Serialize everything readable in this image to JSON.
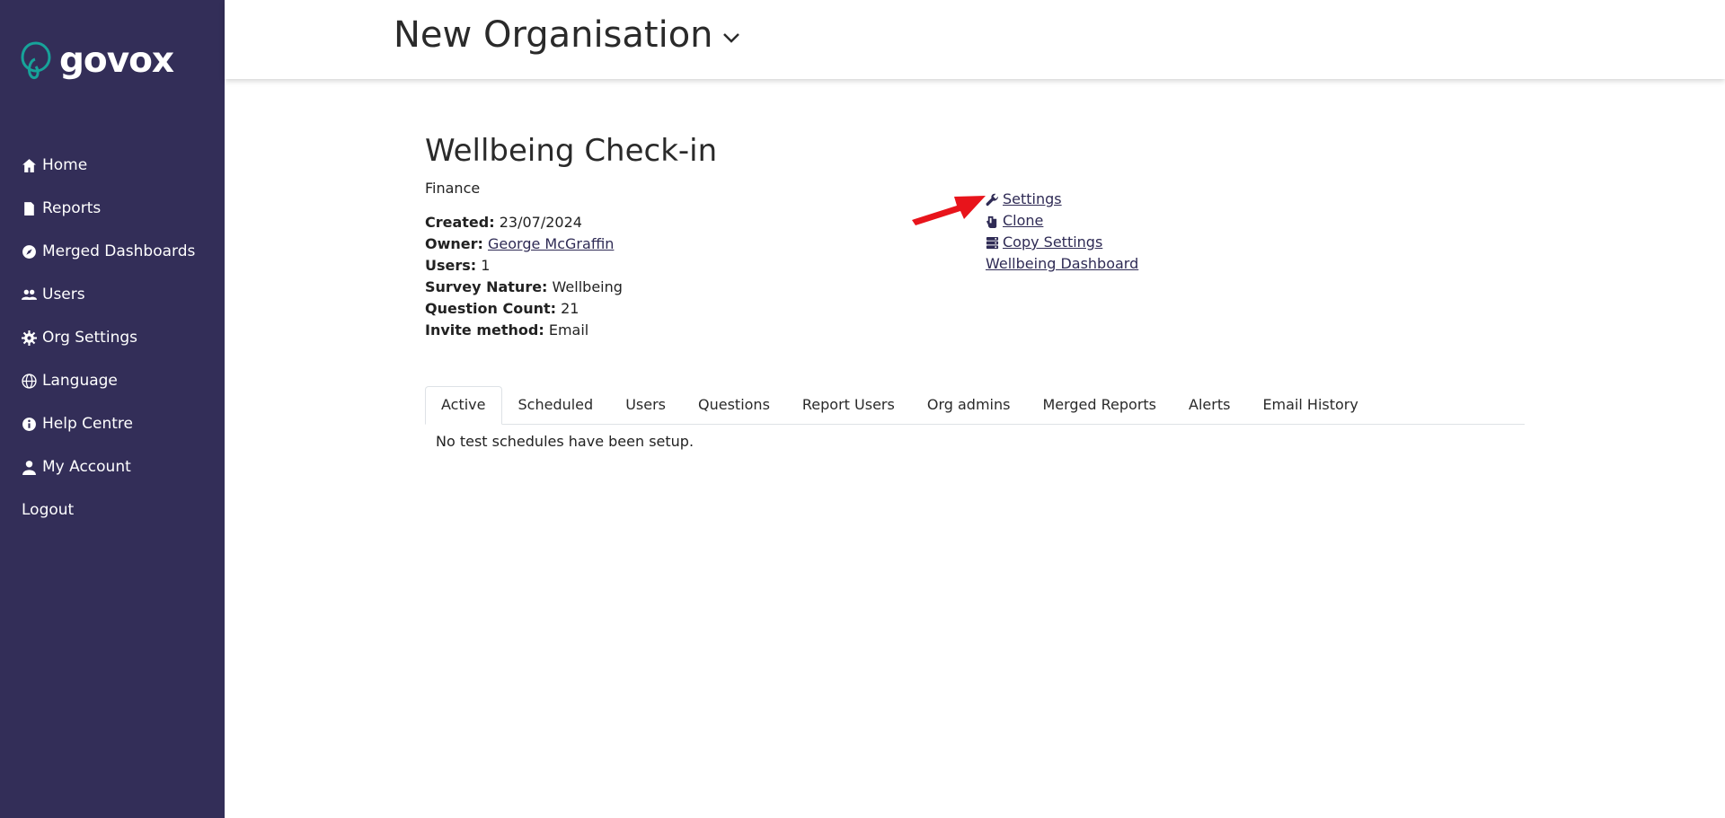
{
  "brand": {
    "name": "govox",
    "accent": "#17a39a",
    "sidebar_bg": "#332e58"
  },
  "nav": [
    {
      "label": "Home",
      "icon": "home-icon"
    },
    {
      "label": "Reports",
      "icon": "file-icon"
    },
    {
      "label": "Merged Dashboards",
      "icon": "compass-icon"
    },
    {
      "label": "Users",
      "icon": "users-icon"
    },
    {
      "label": "Org Settings",
      "icon": "gear-icon"
    },
    {
      "label": "Language",
      "icon": "globe-icon"
    },
    {
      "label": "Help Centre",
      "icon": "info-icon"
    },
    {
      "label": "My Account",
      "icon": "user-icon"
    },
    {
      "label": "Logout",
      "icon": ""
    }
  ],
  "header": {
    "org_name": "New Organisation"
  },
  "survey": {
    "title": "Wellbeing Check-in",
    "department": "Finance",
    "created_label": "Created:",
    "created": "23/07/2024",
    "owner_label": "Owner:",
    "owner": "George McGraffin",
    "users_label": "Users:",
    "users": "1",
    "nature_label": "Survey Nature:",
    "nature": "Wellbeing",
    "qcount_label": "Question Count:",
    "qcount": "21",
    "invite_label": "Invite method:",
    "invite": "Email"
  },
  "actions": {
    "settings": " Settings",
    "clone": " Clone",
    "copy_settings": " Copy Settings",
    "dashboard": "Wellbeing Dashboard"
  },
  "tabs": [
    "Active",
    "Scheduled",
    "Users",
    "Questions",
    "Report Users",
    "Org admins",
    "Merged Reports",
    "Alerts",
    "Email History"
  ],
  "active_tab": "Active",
  "empty_message": "No test schedules have been setup."
}
